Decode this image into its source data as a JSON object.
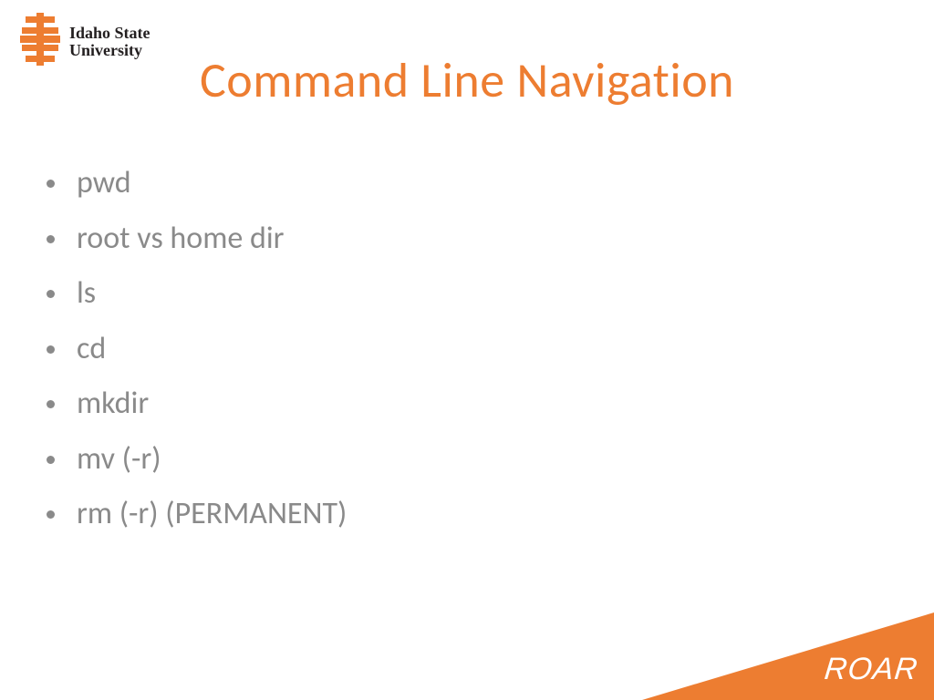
{
  "logo": {
    "line1": "Idaho State",
    "line2": "University"
  },
  "title": "Command Line Navigation",
  "bullets": [
    "pwd",
    "root vs home dir",
    "ls",
    "cd",
    "mkdir",
    "mv (-r)",
    "rm (-r) (PERMANENT)"
  ],
  "corner_text": "ROAR",
  "colors": {
    "accent": "#ed7d31",
    "text_muted": "#8a8a8a",
    "logo_text": "#231f20"
  }
}
